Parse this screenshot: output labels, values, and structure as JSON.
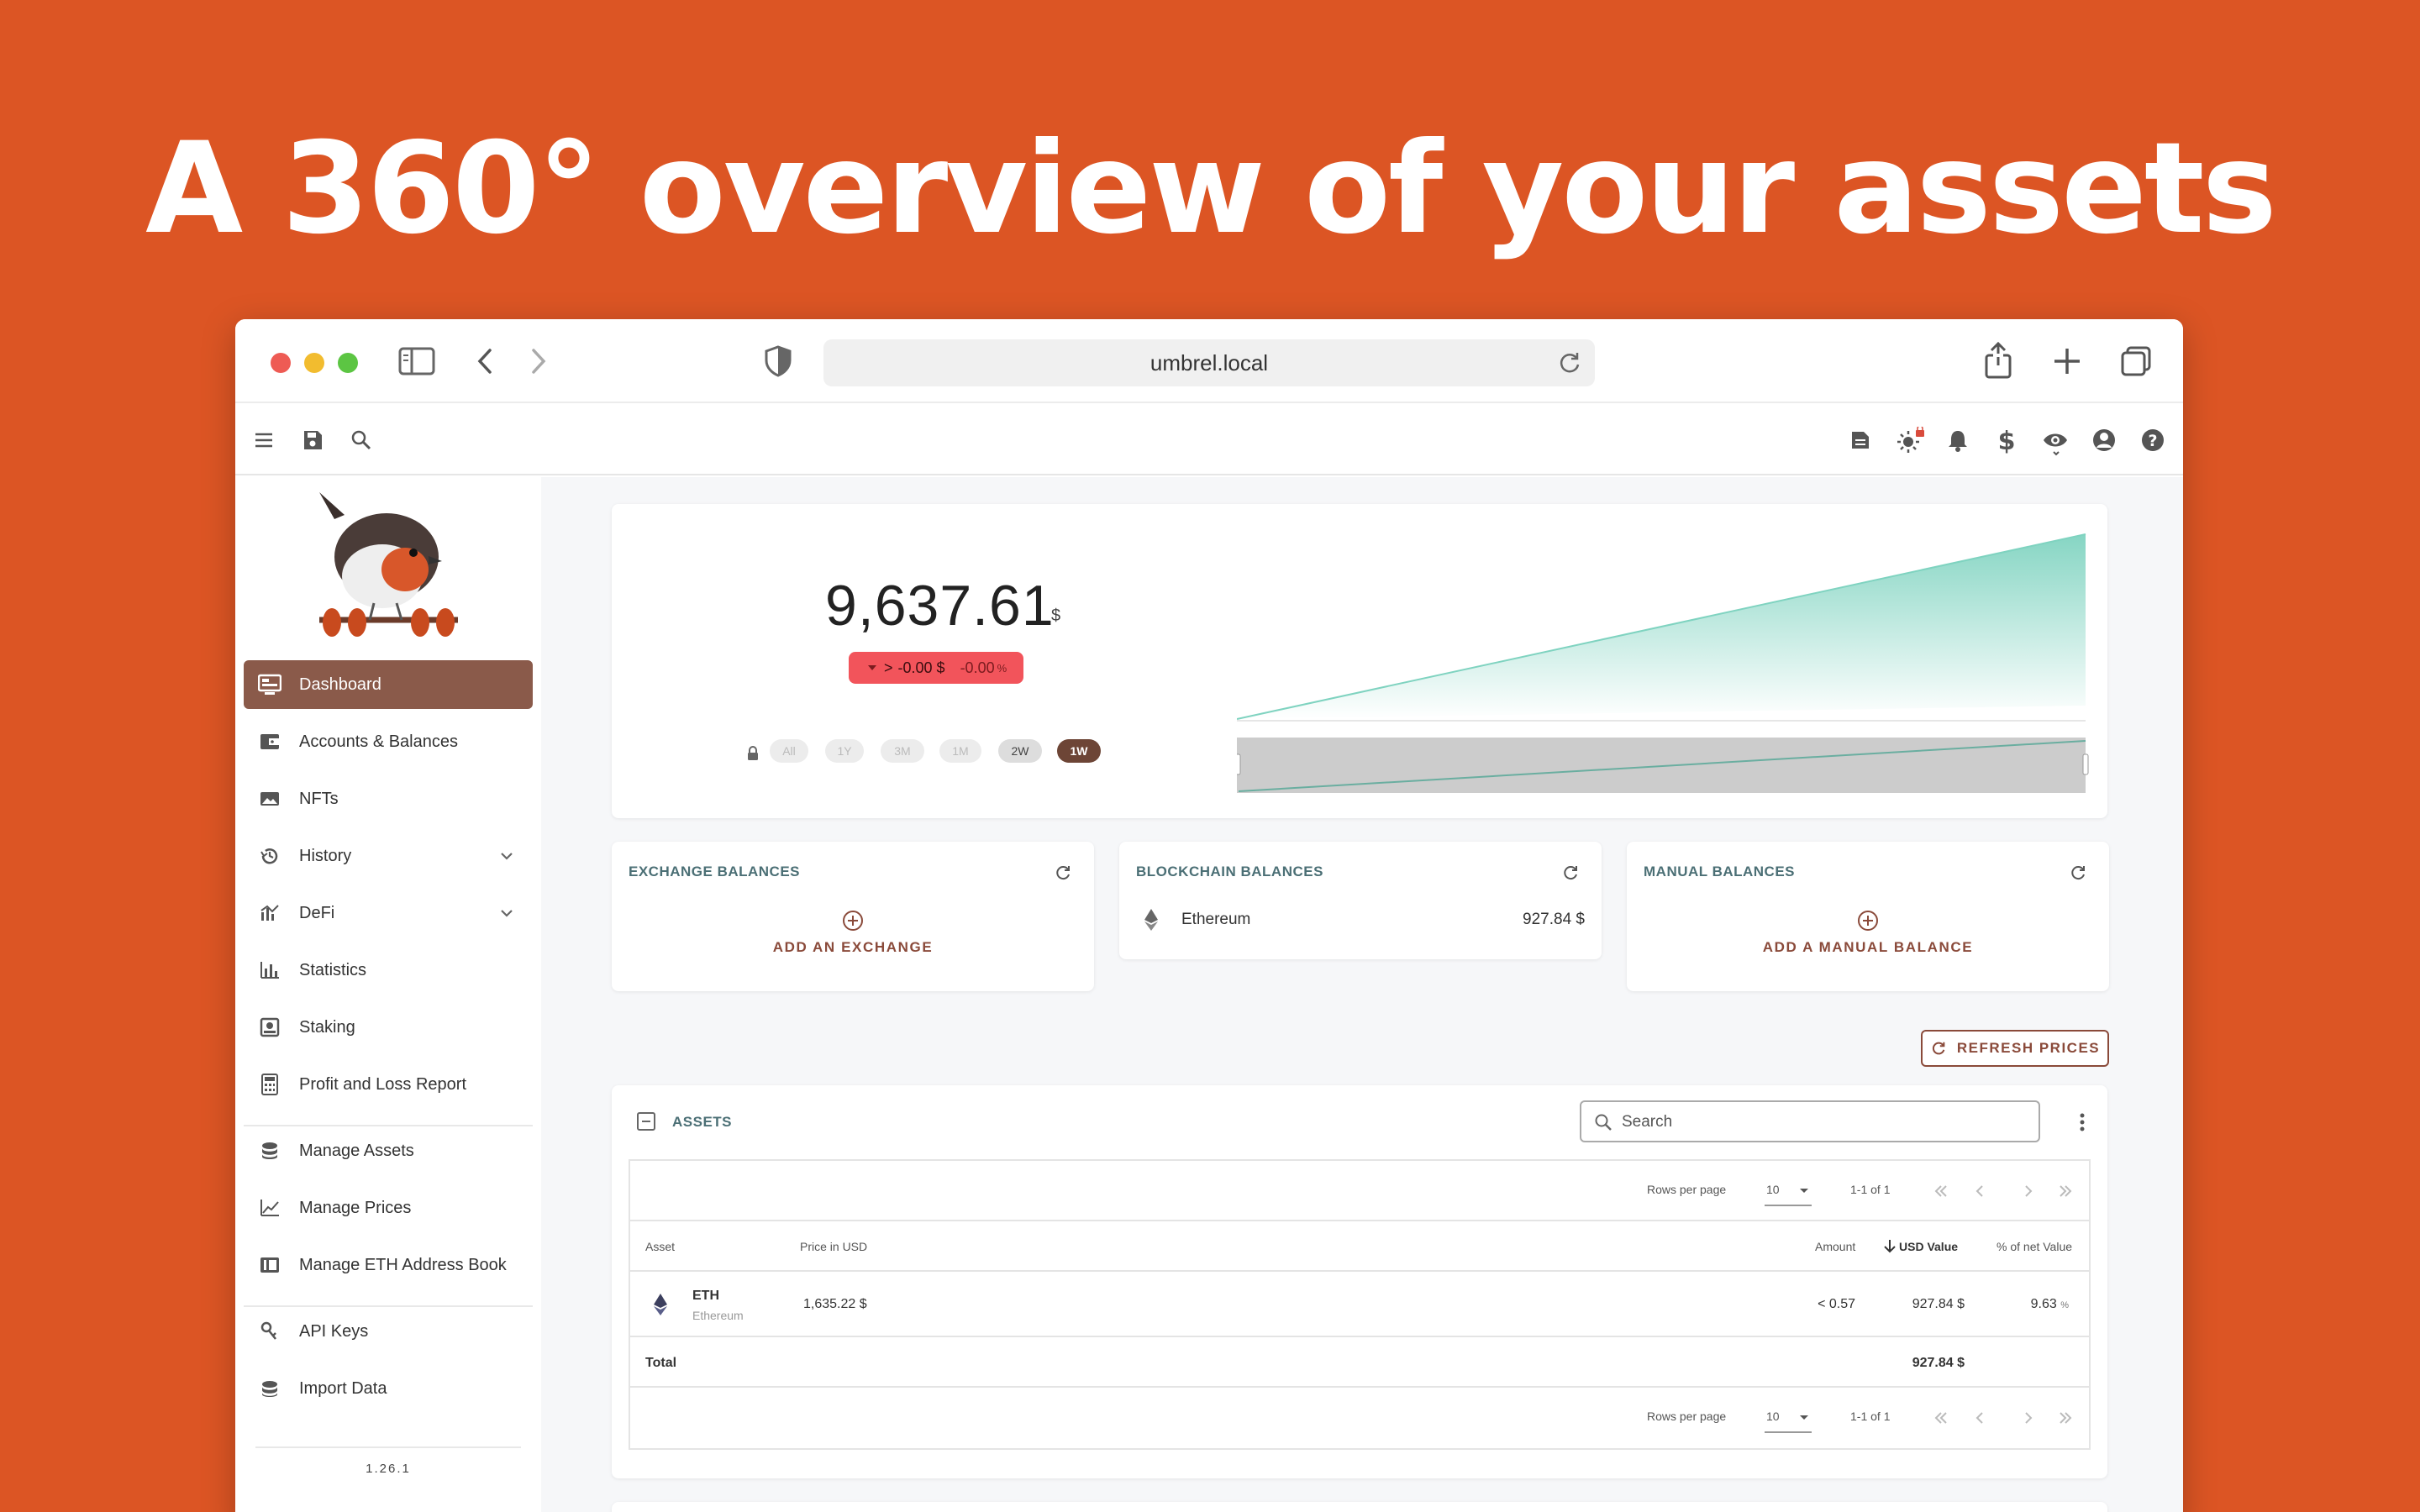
{
  "headline": "A 360° overview of your assets",
  "browser": {
    "url": "umbrel.local"
  },
  "sidebar": {
    "items": [
      {
        "label": "Dashboard",
        "icon": "dashboard-icon",
        "active": true
      },
      {
        "label": "Accounts & Balances",
        "icon": "wallet-icon"
      },
      {
        "label": "NFTs",
        "icon": "image-icon"
      },
      {
        "label": "History",
        "icon": "history-icon",
        "expandable": true
      },
      {
        "label": "DeFi",
        "icon": "defi-icon",
        "expandable": true
      },
      {
        "label": "Statistics",
        "icon": "bar-chart-icon"
      },
      {
        "label": "Staking",
        "icon": "staking-icon"
      },
      {
        "label": "Profit and Loss Report",
        "icon": "calculator-icon"
      },
      {
        "label": "Manage Assets",
        "icon": "coins-icon"
      },
      {
        "label": "Manage Prices",
        "icon": "line-chart-icon"
      },
      {
        "label": "Manage ETH Address Book",
        "icon": "address-book-icon"
      },
      {
        "label": "API Keys",
        "icon": "key-icon"
      },
      {
        "label": "Import Data",
        "icon": "import-icon"
      }
    ],
    "version": "1.26.1"
  },
  "overview": {
    "net_value": "9,637.61",
    "currency": "$",
    "change_prefix": ">",
    "change_value": "-0.00 $",
    "change_percent": "-0.00",
    "change_percent_unit": "%",
    "ranges": [
      "All",
      "1Y",
      "3M",
      "1M",
      "2W",
      "1W"
    ],
    "active_range": "1W"
  },
  "balances": {
    "exchange": {
      "title": "EXCHANGE BALANCES",
      "add_label": "ADD AN EXCHANGE"
    },
    "blockchain": {
      "title": "BLOCKCHAIN BALANCES",
      "chain": "Ethereum",
      "value": "927.84 $"
    },
    "manual": {
      "title": "MANUAL BALANCES",
      "add_label": "ADD A MANUAL BALANCE"
    }
  },
  "refresh_prices_label": "REFRESH PRICES",
  "assets": {
    "title": "ASSETS",
    "search_placeholder": "Search",
    "rows_per_page_label": "Rows per page",
    "rows_per_page": "10",
    "page_info": "1-1 of 1",
    "columns": {
      "asset": "Asset",
      "price": "Price in USD",
      "amount": "Amount",
      "usd_value": "USD Value",
      "percent": "% of net Value"
    },
    "rows": [
      {
        "symbol": "ETH",
        "name": "Ethereum",
        "price": "1,635.22 $",
        "amount": "< 0.57",
        "usd_value": "927.84 $",
        "percent": "9.63",
        "percent_unit": "%"
      }
    ],
    "total_label": "Total",
    "total_value": "927.84 $"
  },
  "colors": {
    "background": "#dc5524",
    "accent": "#8a5a4a",
    "active_pill": "#6d4536",
    "negative": "#f2545b",
    "chart_fill": "#7fd3c0"
  }
}
